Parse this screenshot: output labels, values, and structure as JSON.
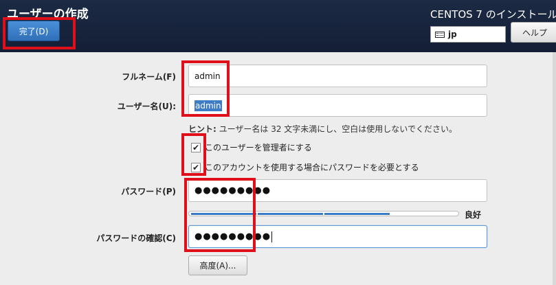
{
  "header": {
    "title": "ユーザーの作成",
    "os_title": "CENTOS 7 のインストール",
    "done_label": "完了(D)",
    "keyboard_layout": "jp",
    "help_label": "ヘルプ"
  },
  "form": {
    "fullname_label": "フルネーム(F)",
    "fullname_value": "admin",
    "username_label": "ユーザー名(U):",
    "username_value": "admin",
    "hint_prefix": "ヒント:",
    "hint_text": "ユーザー名は 32 文字未満にし、空白は使用しないでください。",
    "admin_checkbox_label": "このユーザーを管理者にする",
    "admin_checked": true,
    "require_password_label": "このアカウントを使用する場合にパスワードを必要とする",
    "require_password_checked": true,
    "password_label": "パスワード(P)",
    "password_value": "●●●●●●●●●",
    "strength_label": "良好",
    "strength_level": 0.75,
    "confirm_label": "パスワードの確認(C)",
    "confirm_value": "●●●●●●●●●",
    "advanced_label": "高度(A)..."
  },
  "colors": {
    "header_bg": "#1c2a44",
    "accent": "#3a7bc8",
    "highlight": "#e0101a"
  }
}
